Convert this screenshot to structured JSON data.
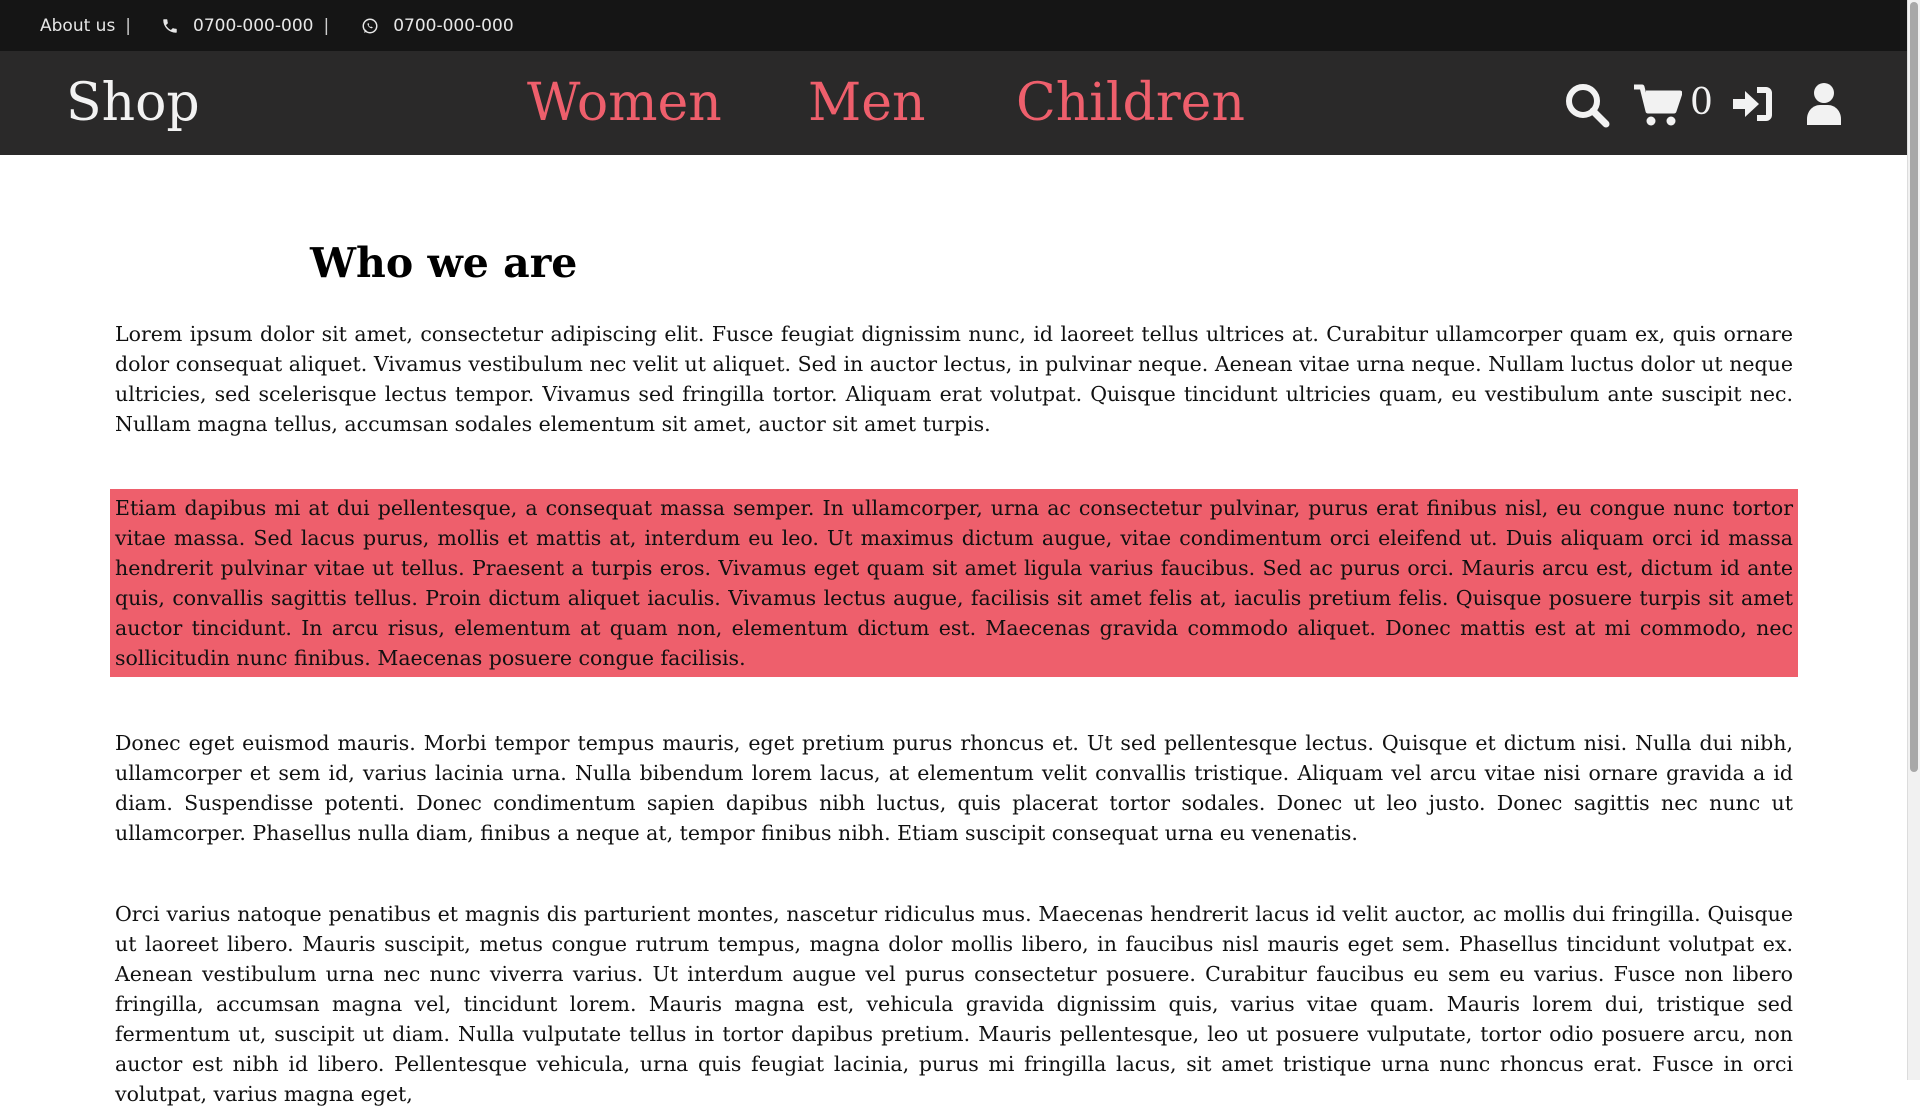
{
  "topbar": {
    "about_label": "About us",
    "separator": "|",
    "phone": "0700-000-000",
    "whatsapp": "0700-000-000",
    "icons": [
      "phone-icon",
      "whatsapp-icon"
    ]
  },
  "navbar": {
    "brand": "Shop",
    "menu": [
      "Women",
      "Men",
      "Children"
    ],
    "cart_count": "0",
    "icons": [
      "search-icon",
      "cart-icon",
      "login-icon",
      "user-icon"
    ]
  },
  "content": {
    "heading": "Who we are",
    "paragraphs": [
      "Lorem ipsum dolor sit amet, consectetur adipiscing elit. Fusce feugiat dignissim nunc, id laoreet tellus ultrices at. Curabitur ullamcorper quam ex, quis ornare dolor consequat aliquet. Vivamus vestibulum nec velit ut aliquet. Sed in auctor lectus, in pulvinar neque. Aenean vitae urna neque. Nullam luctus dolor ut neque ultricies, sed scelerisque lectus tempor. Vivamus sed fringilla tortor. Aliquam erat volutpat. Quisque tincidunt ultricies quam, eu vestibulum ante suscipit nec. Nullam magna tellus, accumsan sodales elementum sit amet, auctor sit amet turpis.",
      "Etiam dapibus mi at dui pellentesque, a consequat massa semper. In ullamcorper, urna ac consectetur pulvinar, purus erat finibus nisl, eu congue nunc tortor vitae massa. Sed lacus purus, mollis et mattis at, interdum eu leo. Ut maximus dictum augue, vitae condimentum orci eleifend ut. Duis aliquam orci id massa hendrerit pulvinar vitae ut tellus. Praesent a turpis eros. Vivamus eget quam sit amet ligula varius faucibus. Sed ac purus orci. Mauris arcu est, dictum id ante quis, convallis sagittis tellus. Proin dictum aliquet iaculis. Vivamus lectus augue, facilisis sit amet felis at, iaculis pretium felis. Quisque posuere turpis sit amet auctor tincidunt. In arcu risus, elementum at quam non, elementum dictum est. Maecenas gravida commodo aliquet. Donec mattis est at mi commodo, nec sollicitudin nunc finibus. Maecenas posuere congue facilisis.",
      "Donec eget euismod mauris. Morbi tempor tempus mauris, eget pretium purus rhoncus et. Ut sed pellentesque lectus. Quisque et dictum nisi. Nulla dui nibh, ullamcorper et sem id, varius lacinia urna. Nulla bibendum lorem lacus, at elementum velit convallis tristique. Aliquam vel arcu vitae nisi ornare gravida a id diam. Suspendisse potenti. Donec condimentum sapien dapibus nibh luctus, quis placerat tortor sodales. Donec ut leo justo. Donec sagittis nec nunc ut ullamcorper. Phasellus nulla diam, finibus a neque at, tempor finibus nibh. Etiam suscipit consequat urna eu venenatis.",
      "Orci varius natoque penatibus et magnis dis parturient montes, nascetur ridiculus mus. Maecenas hendrerit lacus id velit auctor, ac mollis dui fringilla. Quisque ut laoreet libero. Mauris suscipit, metus congue rutrum tempus, magna dolor mollis libero, in faucibus nisl mauris eget sem. Phasellus tincidunt volutpat ex. Aenean vestibulum urna nec nunc viverra varius. Ut interdum augue vel purus consectetur posuere. Curabitur faucibus eu sem eu varius. Fusce non libero fringilla, accumsan magna vel, tincidunt lorem. Mauris magna est, vehicula gravida dignissim quis, varius vitae quam. Mauris lorem dui, tristique sed fermentum ut, suscipit ut diam. Nulla vulputate tellus in tortor dapibus pretium. Mauris pellentesque, leo ut posuere vulputate, tortor odio posuere arcu, non auctor est nibh id libero. Pellentesque vehicula, urna quis feugiat lacinia, purus mi fringilla lacus, sit amet tristique urna nunc rhoncus erat. Fusce in orci volutpat, varius magna eget,"
    ]
  },
  "colors": {
    "topbar_bg": "#151515",
    "navbar_bg": "#2a2929",
    "accent": "#ee5f6c",
    "page_bg": "#ffffff"
  }
}
